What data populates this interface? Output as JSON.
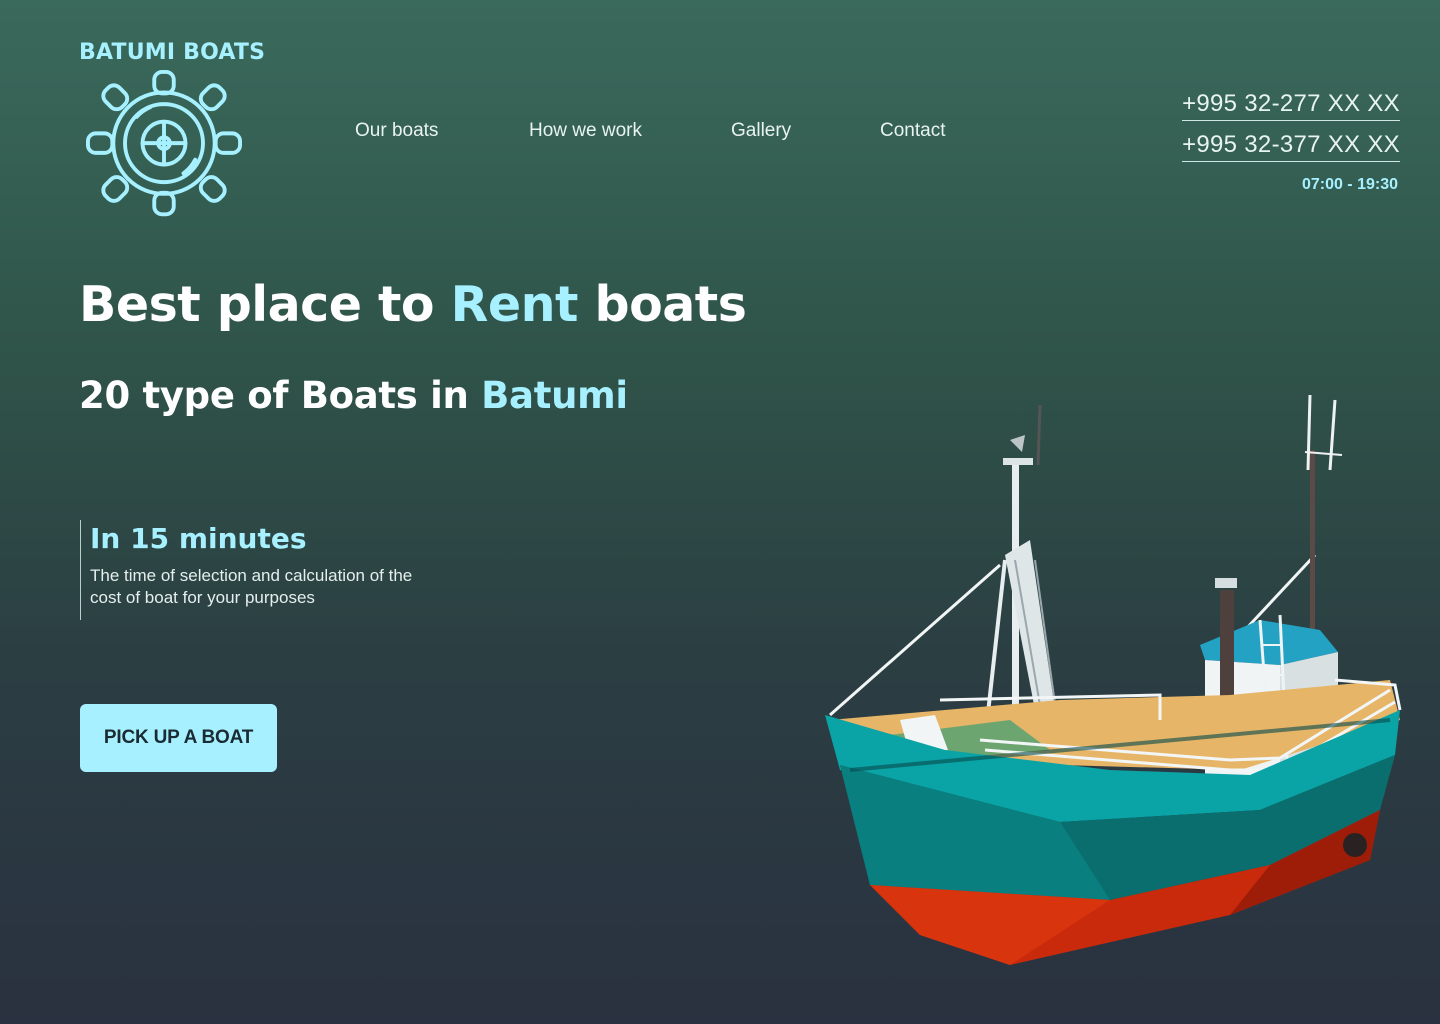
{
  "brand": {
    "name": "BATUMI BOATS",
    "icon": "ship-wheel-icon"
  },
  "nav": {
    "items": [
      {
        "label": "Our boats"
      },
      {
        "label": "How we work"
      },
      {
        "label": "Gallery"
      },
      {
        "label": "Contact"
      }
    ]
  },
  "contacts": {
    "phone_1": "+995 32-277 XX XX",
    "phone_2": "+995 32-377 XX XX",
    "hours": "07:00 - 19:30"
  },
  "hero": {
    "title_part1": "Best place to ",
    "title_accent": "Rent",
    "title_part2": " boats",
    "subtitle_part1": "20 type of Boats in ",
    "subtitle_accent": "Batumi"
  },
  "feature": {
    "title": "In 15 minutes",
    "description": "The time of selection and calculation of the cost of boat for your purposes"
  },
  "cta": {
    "label": "PICK UP A BOAT"
  },
  "illustration": {
    "icon": "fishing-boat-illustration"
  },
  "colors": {
    "accent": "#a6f0ff",
    "background_top": "#3a6a5c",
    "background_bottom": "#2a3140",
    "boat_hull_teal": "#0a8d93",
    "boat_hull_red": "#c92a0c"
  }
}
